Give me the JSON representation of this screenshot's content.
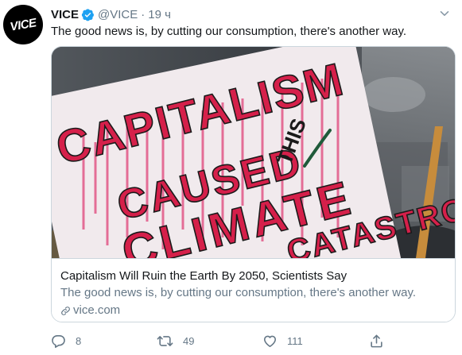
{
  "tweet": {
    "author_name": "VICE",
    "handle": "@VICE",
    "separator": "·",
    "time": "19 ч",
    "text": "The good news is, by cutting our consumption, there's another way.",
    "avatar_logo_text": "VICE"
  },
  "card": {
    "image_sign_text": [
      "CAPITALISM",
      "CAUSED",
      "THIS",
      "CLIMATE",
      "CATASTROPHE"
    ],
    "title": "Capitalism Will Ruin the Earth By 2050, Scientists Say",
    "description": "The good news is, by cutting our consumption, there's another way.",
    "domain": "vice.com"
  },
  "actions": {
    "replies": "8",
    "retweets": "49",
    "likes": "111"
  },
  "colors": {
    "text_primary": "#14171a",
    "text_secondary": "#657786",
    "verified_blue": "#1da1f2",
    "border": "#ccd6dd",
    "sign_red": "#d5204a",
    "sign_green": "#1f5a3a"
  }
}
